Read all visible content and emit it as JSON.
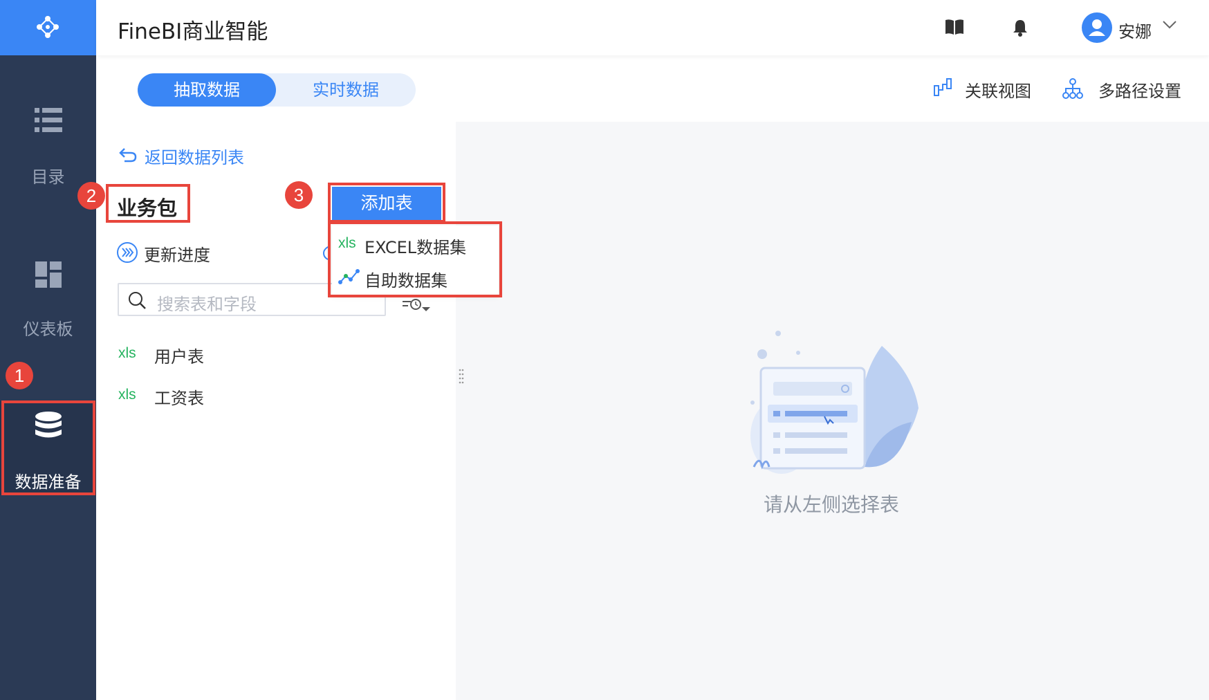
{
  "app": {
    "title": "FineBI商业智能"
  },
  "nav": {
    "items": [
      {
        "label": "目录",
        "icon": "list-icon"
      },
      {
        "label": "仪表板",
        "icon": "dashboard-icon"
      },
      {
        "label": "数据准备",
        "icon": "database-icon",
        "active": true
      }
    ]
  },
  "header": {
    "icons": [
      "book-icon",
      "bell-icon"
    ],
    "user": {
      "name": "安娜"
    }
  },
  "toolbar": {
    "tabs": [
      {
        "label": "抽取数据",
        "selected": true
      },
      {
        "label": "实时数据",
        "selected": false
      }
    ],
    "relation_view": "关联视图",
    "multipath": "多路径设置"
  },
  "panel": {
    "back": "返回数据列表",
    "package_title": "业务包",
    "add_table": "添加表",
    "update_progress": "更新进度",
    "search_placeholder": "搜索表和字段",
    "tables": [
      {
        "badge": "xls",
        "name": "用户表"
      },
      {
        "badge": "xls",
        "name": "工资表"
      }
    ]
  },
  "dropdown": {
    "items": [
      {
        "badge": "xls",
        "label": "EXCEL数据集"
      },
      {
        "label": "自助数据集"
      }
    ]
  },
  "annotations": {
    "step1": "1",
    "step2": "2",
    "step3": "3"
  },
  "empty_state": {
    "text": "请从左侧选择表"
  },
  "colors": {
    "accent": "#3a86f5",
    "nav_bg": "#2b3a55",
    "highlight": "#e8453c",
    "xls": "#24b35e"
  }
}
